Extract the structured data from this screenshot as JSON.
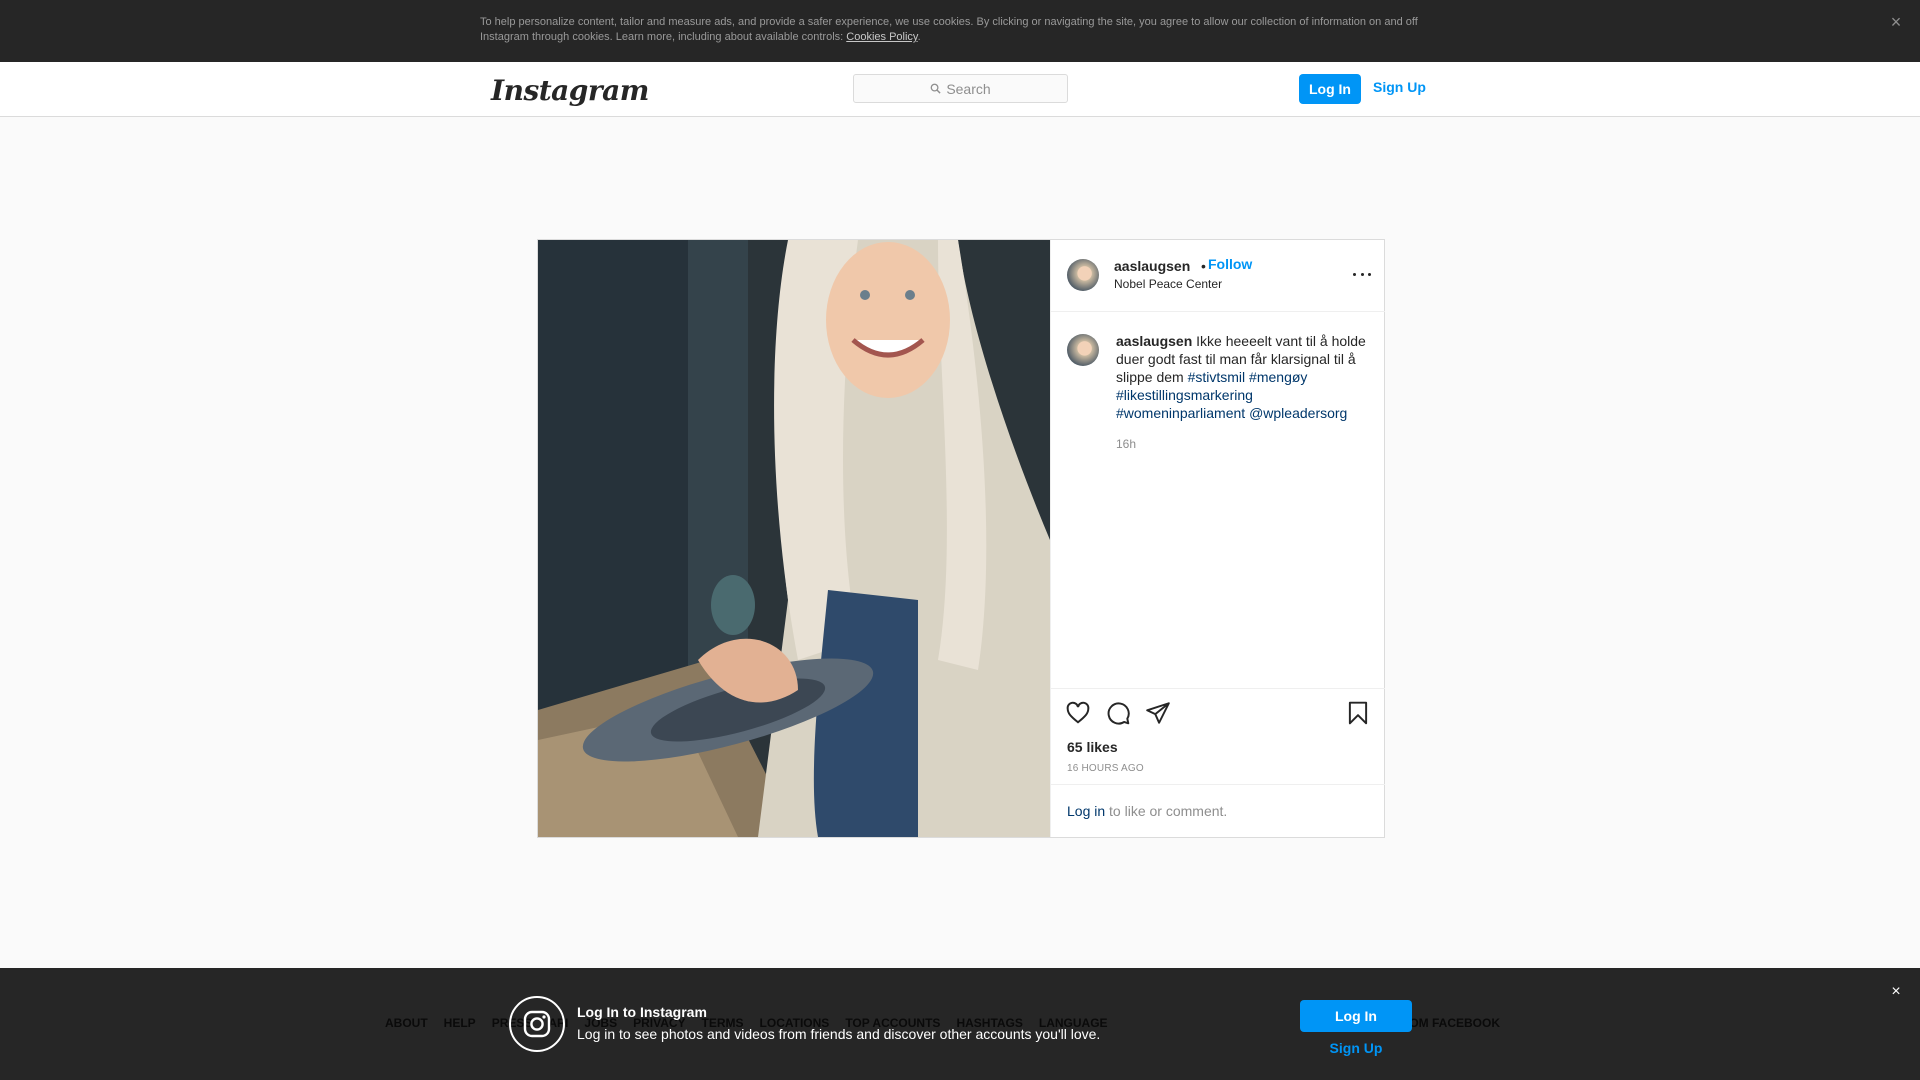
{
  "cookie_banner": {
    "text": "To help personalize content, tailor and measure ads, and provide a safer experience, we use cookies. By clicking or navigating the site, you agree to allow our collection of information on and off Instagram through cookies. Learn more, including about available controls: ",
    "link": "Cookies Policy",
    "close_icon": "×"
  },
  "header": {
    "logo": "Instagram",
    "search_placeholder": "Search",
    "login_label": "Log In",
    "signup_label": "Sign Up"
  },
  "post": {
    "username": "aaslaugsen",
    "dot": "•",
    "follow_label": "Follow",
    "location": "Nobel Peace Center",
    "caption_user": "aaslaugsen",
    "caption_text": "Ikke heeeelt vant til å holde duer godt fast til man får klarsignal til å slippe dem",
    "caption_emoji": "",
    "tags": [
      "#stivtsmil",
      "#mengøy",
      "#likestillingsmarkering",
      "#womeninparliament",
      "@wpleadersorg"
    ],
    "caption_time": "16h",
    "likes": "65 likes",
    "posted_ago": "16 HOURS AGO",
    "comment_login_link": "Log in",
    "comment_prompt": " to like or comment."
  },
  "footer": {
    "links": [
      "ABOUT",
      "HELP",
      "PRESS",
      "API",
      "JOBS",
      "PRIVACY",
      "TERMS",
      "LOCATIONS",
      "TOP ACCOUNTS",
      "HASHTAGS",
      "LANGUAGE"
    ],
    "copyright": "M FROM FACEBOOK"
  },
  "login_overlay": {
    "title": "Log In to Instagram",
    "subtitle": "Log in to see photos and videos from friends and discover other accounts you'll love.",
    "login_label": "Log In",
    "signup_label": "Sign Up",
    "close_icon": "×"
  },
  "colors": {
    "accent": "#0095f6",
    "link_dark": "#00376b",
    "dark_bar": "#262626"
  }
}
